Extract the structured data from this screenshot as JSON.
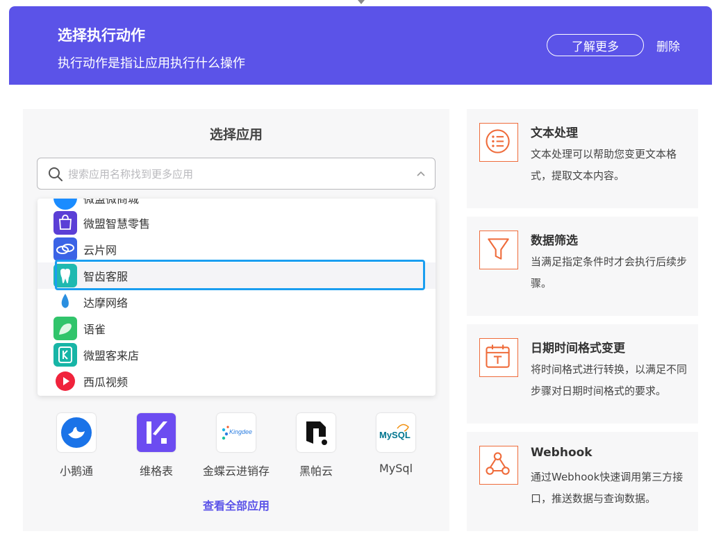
{
  "header": {
    "title": "选择执行动作",
    "subtitle": "执行动作是指让应用执行什么操作",
    "learn_more": "了解更多",
    "delete": "删除"
  },
  "left": {
    "title": "选择应用",
    "search_placeholder": "搜索应用名称找到更多应用",
    "dropdown": [
      {
        "label": "微盟微商城",
        "icon": "weimob-mall-icon"
      },
      {
        "label": "微盟智慧零售",
        "icon": "weimob-retail-icon"
      },
      {
        "label": "云片网",
        "icon": "yunpian-icon"
      },
      {
        "label": "智齿客服",
        "icon": "sobot-icon",
        "selected": true
      },
      {
        "label": "达摩网络",
        "icon": "damo-icon"
      },
      {
        "label": "语雀",
        "icon": "yuque-icon"
      },
      {
        "label": "微盟客来店",
        "icon": "weimob-kelaidian-icon"
      },
      {
        "label": "西瓜视频",
        "icon": "xigua-icon"
      }
    ],
    "apps": [
      {
        "label": "小鹅通",
        "icon": "xiaoetong-icon"
      },
      {
        "label": "维格表",
        "icon": "vika-icon"
      },
      {
        "label": "金蝶云进销存",
        "icon": "kingdee-icon",
        "logo_text": "Kingdee"
      },
      {
        "label": "黑帕云",
        "icon": "hipacloud-icon"
      },
      {
        "label": "MySql",
        "icon": "mysql-icon",
        "logo_text": "MySQL"
      }
    ],
    "view_all": "查看全部应用"
  },
  "actions": [
    {
      "title": "文本处理",
      "desc": "文本处理可以帮助您变更文本格式，提取文本内容。",
      "icon": "text-process-icon"
    },
    {
      "title": "数据筛选",
      "desc": "当满足指定条件时才会执行后续步骤。",
      "icon": "filter-icon"
    },
    {
      "title": "日期时间格式变更",
      "desc": "将时间格式进行转换，以满足不同步骤对日期时间格式的要求。",
      "icon": "calendar-icon"
    },
    {
      "title": "Webhook",
      "desc": "通过Webhook快速调用第三方接口，推送数据与查询数据。",
      "icon": "webhook-icon"
    }
  ],
  "colors": {
    "brand": "#5b53e8",
    "accent": "#ef6b3a",
    "highlight": "#1a9ef0"
  }
}
